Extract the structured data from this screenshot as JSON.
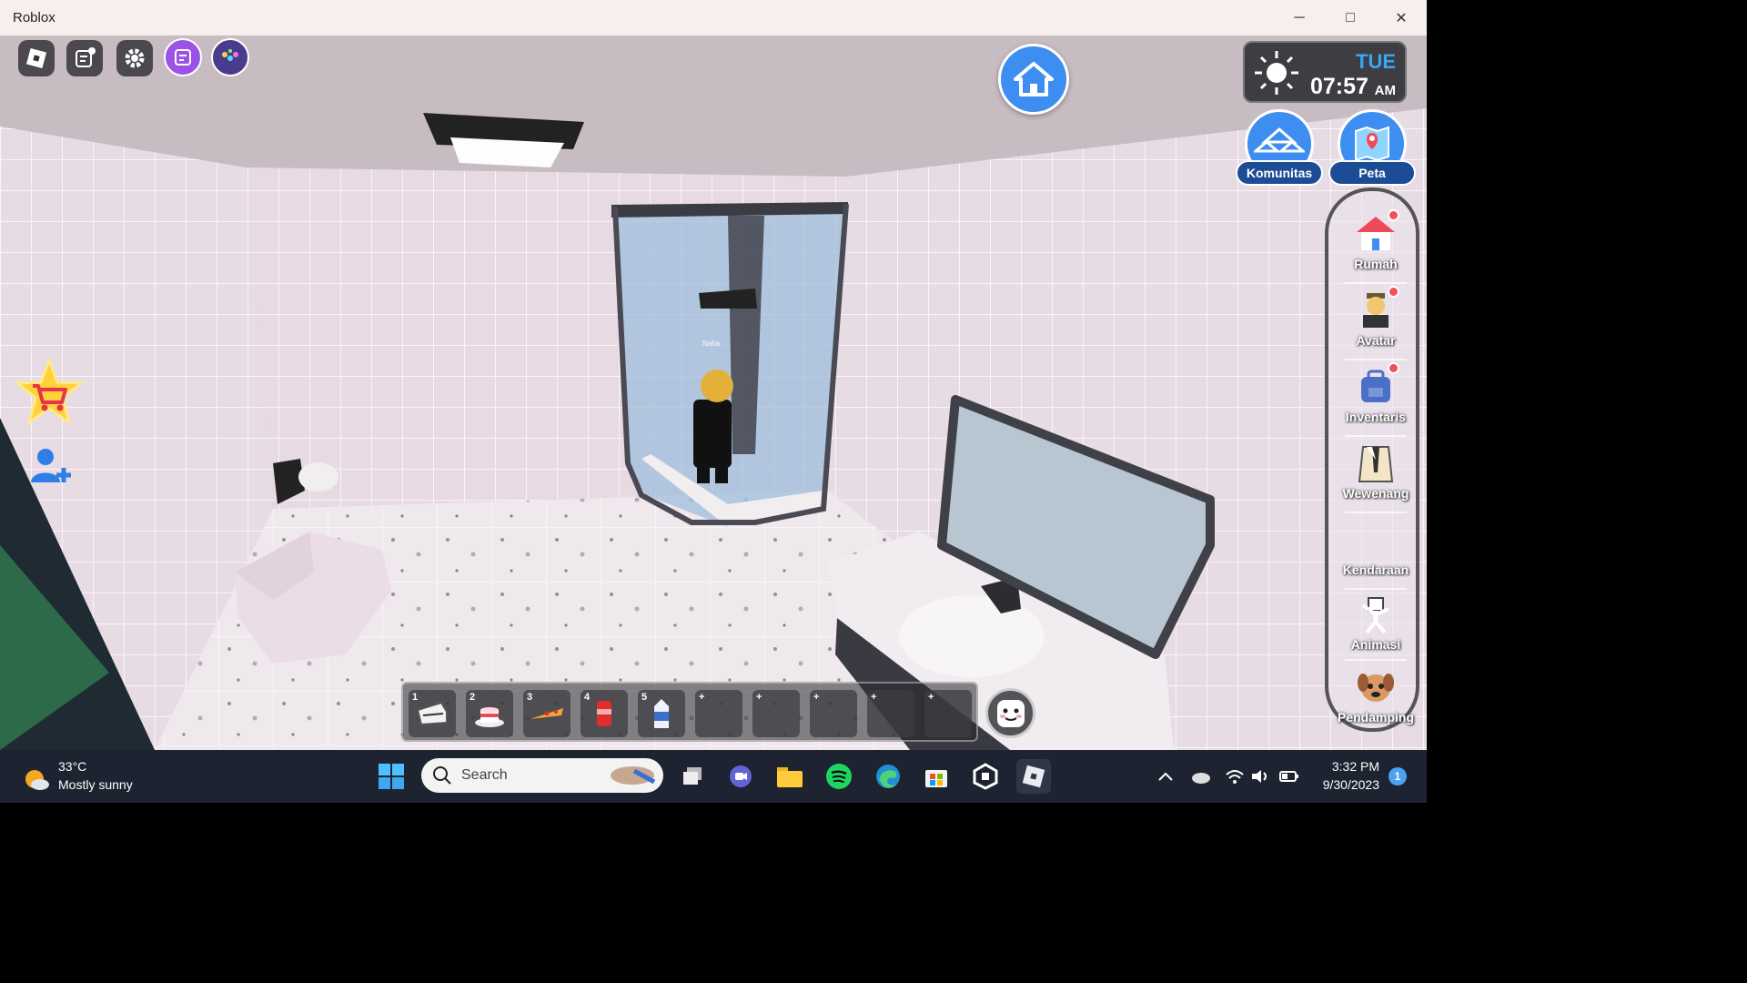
{
  "window": {
    "title": "Roblox",
    "controls": [
      "─",
      "□",
      "✕"
    ]
  },
  "hud": {
    "clock": {
      "day": "TUE",
      "time": "07:57",
      "ampm": "AM"
    },
    "komunitas_label": "Komunitas",
    "peta_label": "Peta",
    "player_name": "Naha"
  },
  "side_menu": [
    {
      "label": "Rumah",
      "icon": "house-icon",
      "dot": true
    },
    {
      "label": "Avatar",
      "icon": "avatar-icon",
      "dot": true
    },
    {
      "label": "Inventaris",
      "icon": "backpack-icon",
      "dot": true
    },
    {
      "label": "Wewenang",
      "icon": "suit-icon",
      "dot": false
    },
    {
      "label": "Kendaraan",
      "icon": "vehicle-icon",
      "dot": false
    },
    {
      "label": "Animasi",
      "icon": "dance-icon",
      "dot": false
    },
    {
      "label": "Pendamping",
      "icon": "pet-icon",
      "dot": false
    }
  ],
  "hotbar": [
    {
      "num": "1",
      "item": "piano-icon"
    },
    {
      "num": "2",
      "item": "cake-icon"
    },
    {
      "num": "3",
      "item": "pizza-icon"
    },
    {
      "num": "4",
      "item": "soda-can-icon"
    },
    {
      "num": "5",
      "item": "milk-carton-icon"
    },
    {
      "num": "",
      "item": "empty-slot",
      "plus": "+"
    },
    {
      "num": "",
      "item": "empty-slot",
      "plus": "+"
    },
    {
      "num": "",
      "item": "empty-slot",
      "plus": "+"
    },
    {
      "num": "",
      "item": "empty-slot",
      "plus": "+"
    },
    {
      "num": "",
      "item": "empty-slot",
      "plus": "+"
    }
  ],
  "taskbar": {
    "weather_temp": "33°C",
    "weather_desc": "Mostly sunny",
    "search_placeholder": "Search",
    "time": "3:32 PM",
    "date": "9/30/2023",
    "notifications": "1"
  },
  "colors": {
    "accent_blue": "#3d8ef0",
    "clock_day": "#36a8f5",
    "taskbar": "#1d2330"
  }
}
